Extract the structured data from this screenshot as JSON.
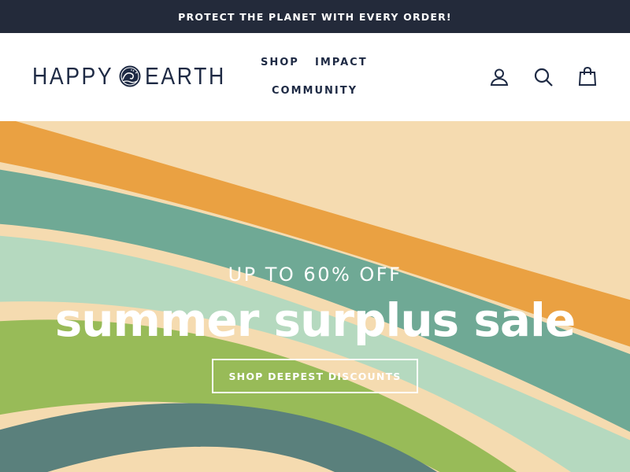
{
  "announcement": {
    "text": "PROTECT THE PLANET WITH EVERY ORDER!"
  },
  "header": {
    "logo": {
      "word1": "HAPPY",
      "word2": "EARTH",
      "emblem_icon": "wave-emblem-icon"
    },
    "nav": [
      {
        "label": "SHOP"
      },
      {
        "label": "IMPACT"
      },
      {
        "label": "COMMUNITY"
      }
    ],
    "icons": [
      "account-icon",
      "search-icon",
      "cart-icon"
    ]
  },
  "hero": {
    "eyebrow": "UP TO 60% OFF",
    "title": "summer surplus sale",
    "cta_label": "SHOP DEEPEST DISCOUNTS"
  },
  "colors": {
    "announcement_bg": "#232a3a",
    "brand_navy": "#1e2a44",
    "hero_sand": "#f5dbb0",
    "stripe_orange": "#eaa142",
    "stripe_teal": "#6fa995",
    "stripe_mint": "#b5d9bf",
    "stripe_green": "#98bb58",
    "stripe_slate": "#5a807c"
  }
}
